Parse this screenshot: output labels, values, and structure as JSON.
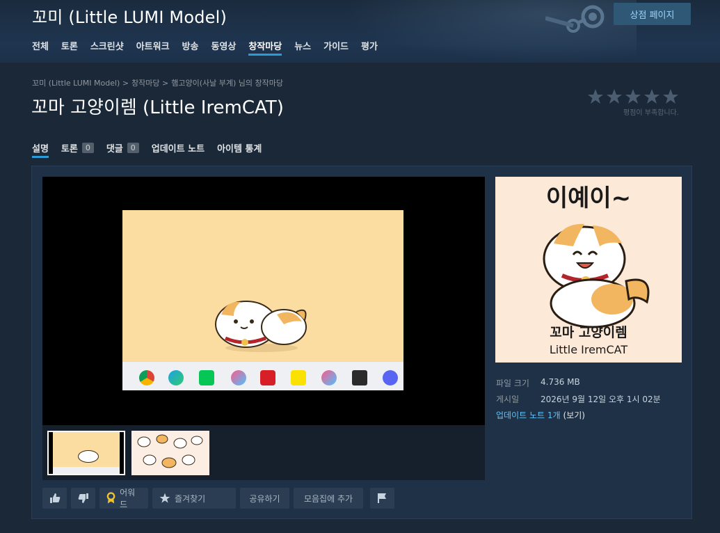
{
  "header": {
    "app_title": "꼬미 (Little LUMI Model)",
    "store_button": "상점 페이지",
    "nav": [
      "전체",
      "토론",
      "스크린샷",
      "아트워크",
      "방송",
      "동영상",
      "창작마당",
      "뉴스",
      "가이드",
      "평가"
    ],
    "active_nav": "창작마당"
  },
  "breadcrumb": {
    "root": "꼬미 (Little LUMI Model) >",
    "section": "창작마당 >",
    "author": "햄고양이(사날 부계) 님의 창작마당"
  },
  "item": {
    "title": "꼬마 고양이렘 (Little IremCAT)",
    "rating_stars": 0,
    "rating_max": 5,
    "rating_note": "평점이 부족합니다."
  },
  "tabs": {
    "description": "설명",
    "discussions": "토론",
    "discussions_count": "0",
    "comments": "댓글",
    "comments_count": "0",
    "changenotes": "업데이트 노트",
    "stats": "아이템 통계"
  },
  "preview": {
    "title_text": "이예이~",
    "caption_ko": "꼬마 고양이렘",
    "caption_en": "Little IremCAT"
  },
  "meta": {
    "size_label": "파일 크기",
    "size_value": "4.736 MB",
    "posted_label": "게시일",
    "posted_value": "2026년 9월 12일 오후 1시 02분",
    "update_link": "업데이트 노트 1개",
    "view_link": "(보기)"
  },
  "actions": {
    "award": "어워드",
    "favorite": "즐겨찾기",
    "share": "공유하기",
    "add_collection": "모음집에 추가"
  },
  "colors": {
    "background": "#1b2838",
    "accent": "#2b9bd8",
    "link": "#66c0f4",
    "panel": "#1f3146"
  }
}
